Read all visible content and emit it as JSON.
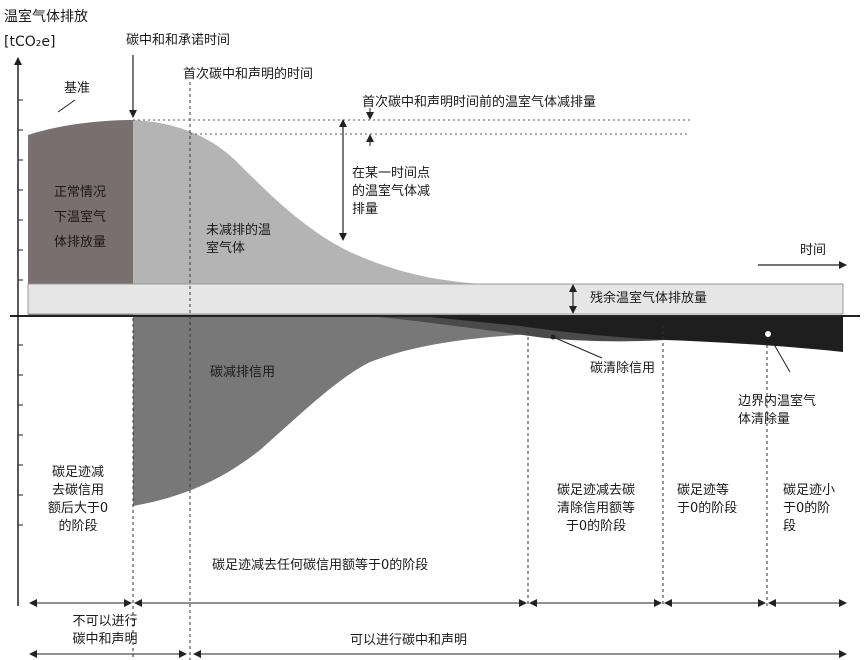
{
  "axes": {
    "y_label": "温室气体排放",
    "y_unit": "[tCO₂e]",
    "x_label": "时间"
  },
  "milestones": {
    "carbon_neutral_time": "碳中和和承诺时间",
    "first_declaration_time": "首次碳中和声明的时间",
    "baseline": "基准",
    "reduction_before_first": "首次碳中和声明时间前的温室气体减排量",
    "reduction_at_point": "在某一时间点\n的温室气体减\n排量"
  },
  "areas": {
    "normal_emissions": "正常情况\n下温室气\n体排放量",
    "unreduced": "未减排的温\n室气体",
    "residual": "残余温室气体排放量",
    "offset_credits": "碳减排信用",
    "removal_credits": "碳清除信用",
    "in_boundary_removal": "边界内温室气\n体清除量"
  },
  "phases": {
    "phase1": "碳足迹减\n去碳信用\n额后大于0\n的阶段",
    "phase2": "碳足迹减去任何碳信用额等于0的阶段",
    "phase3": "碳足迹减去碳\n清除信用额等\n于0的阶段",
    "phase4": "碳足迹等\n于0的阶段",
    "phase5": "碳足迹小\n于0的阶\n段"
  },
  "timeline": {
    "cannot_declare": "不可以进行\n碳中和声明",
    "can_declare": "可以进行碳中和声明"
  }
}
